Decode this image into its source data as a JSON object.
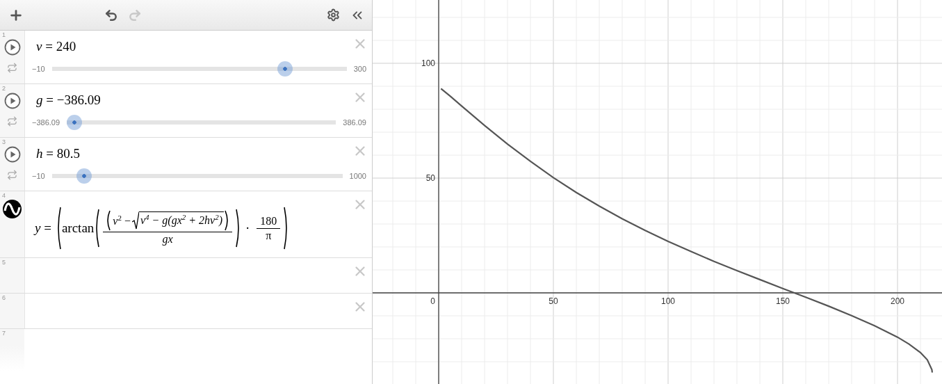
{
  "toolbar": [
    {
      "kind": "add",
      "disabled": false
    },
    {
      "kind": "undo",
      "disabled": false
    },
    {
      "kind": "redo",
      "disabled": true
    },
    {
      "kind": "settings",
      "disabled": false
    },
    {
      "kind": "collapse",
      "disabled": false
    }
  ],
  "expressions": [
    {
      "kind": "slider",
      "number": "1",
      "latex": "*v* = 240",
      "min": "−10",
      "max": "300",
      "level": 0.806
    },
    {
      "kind": "slider",
      "number": "2",
      "latex": "*g* = −386.09",
      "min": "−386.09",
      "max": "386.09",
      "level": 0
    },
    {
      "kind": "slider",
      "number": "3",
      "latex": "*h* = 80.5",
      "min": "−10",
      "max": "1000",
      "level": 0.0896
    },
    {
      "kind": "function",
      "number": "4",
      "lhs": "*y* =",
      "func": "arctan",
      "numerator_lead": "*v*$^{2}$ −",
      "radicand": "v$^{4}$ − g(gx$^{2}$ + 2hv$^{2}$)",
      "denominator": "*gx*",
      "operator": "·",
      "factor_numerator": "180",
      "factor_denominator": "π"
    },
    {
      "kind": "empty",
      "number": "5"
    },
    {
      "kind": "empty",
      "number": "6"
    },
    {
      "kind": "new",
      "number": "7"
    }
  ],
  "graph": {
    "chart_data": {
      "type": "line",
      "x": [
        1,
        5,
        10,
        20,
        30,
        40,
        50,
        60,
        70,
        80,
        90,
        100,
        110,
        120,
        130,
        140,
        150,
        160,
        170,
        180,
        190,
        200,
        205,
        210,
        213,
        215,
        215.119
      ],
      "series": [
        {
          "color": "#555555",
          "values": [
            89,
            85.7,
            81.4,
            72.9,
            64.8,
            57.3,
            50.2,
            43.7,
            37.8,
            32.3,
            27.2,
            22.4,
            18,
            13.7,
            9.7,
            5.8,
            1.9,
            -1.9,
            -5.8,
            -9.9,
            -14.3,
            -19.3,
            -22.3,
            -26,
            -29.2,
            -33.5,
            -34.7
          ]
        }
      ],
      "grid": true,
      "xlim": [
        -28.79,
        219.39
      ],
      "ylim": [
        -39.7,
        127.58
      ],
      "xticks": [
        0,
        50,
        100,
        150,
        200
      ],
      "yticks": [
        50,
        100
      ]
    }
  }
}
